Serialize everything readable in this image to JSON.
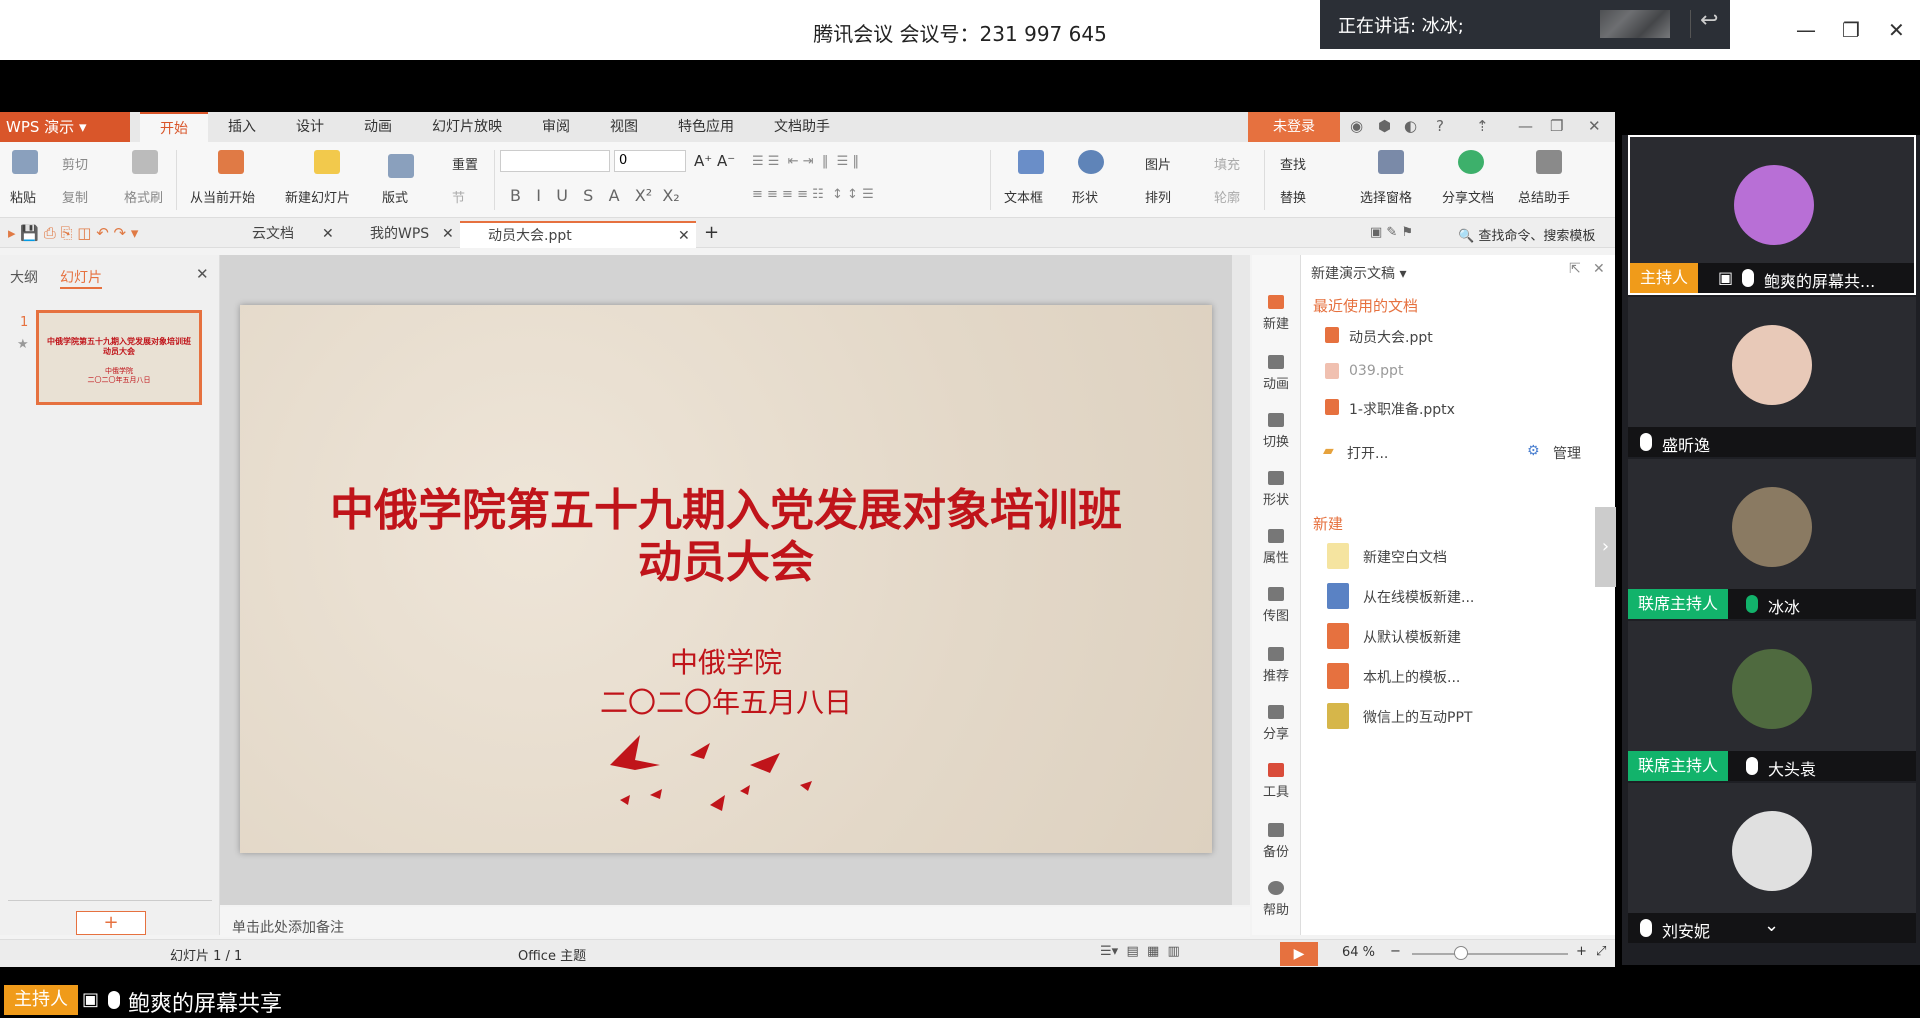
{
  "meeting": {
    "title": "腾讯会议 会议号：231 997 645",
    "speaking": "正在讲话: 冰冰;"
  },
  "wps": {
    "app_name": "WPS 演示",
    "menu_tabs": [
      "开始",
      "插入",
      "设计",
      "动画",
      "幻灯片放映",
      "审阅",
      "视图",
      "特色应用",
      "文档助手"
    ],
    "login": "未登录",
    "ribbon": {
      "paste": "粘贴",
      "cut": "剪切",
      "copy": "复制",
      "format_painter": "格式刷",
      "from_current": "从当前开始",
      "new_slide": "新建幻灯片",
      "layout": "版式",
      "reset": "重置",
      "section": "节",
      "font_size": "0",
      "textbox": "文本框",
      "shape": "形状",
      "picture": "图片",
      "fill": "填充",
      "arrange": "排列",
      "outline": "轮廓",
      "find": "查找",
      "replace": "替换",
      "selection_pane": "选择窗格",
      "share_doc": "分享文档",
      "summary": "总结助手"
    },
    "doc_tabs": [
      "云文档",
      "我的WPS",
      "动员大会.ppt"
    ],
    "search_cmd": "查找命令、搜索模板",
    "left_tabs": {
      "outline": "大纲",
      "slides": "幻灯片"
    },
    "slide_number": "1",
    "thumb_title": "中俄学院第五十九期入党发展对象培训班动员大会",
    "thumb_sub": "中俄学院\n二〇二〇年五月八日",
    "slide": {
      "title_line1": "中俄学院第五十九期入党发展对象培训班",
      "title_line2": "动员大会",
      "sub_line1": "中俄学院",
      "sub_line2": "二〇二〇年五月八日"
    },
    "notes": "单击此处添加备注",
    "side_tools": [
      "新建",
      "动画",
      "切换",
      "形状",
      "属性",
      "传图",
      "推荐",
      "分享",
      "工具",
      "备份",
      "帮助"
    ],
    "task_pane": {
      "title": "新建演示文稿",
      "recent_header": "最近使用的文档",
      "recent": [
        "动员大会.ppt",
        "039.ppt",
        "1-求职准备.pptx"
      ],
      "open": "打开...",
      "manage": "管理",
      "new_header": "新建",
      "new_items": [
        "新建空白文档",
        "从在线模板新建...",
        "从默认模板新建",
        "本机上的模板...",
        "微信上的互动PPT"
      ]
    },
    "status": {
      "slide_info": "幻灯片 1 / 1",
      "theme": "Office 主题",
      "zoom": "64 %"
    }
  },
  "participants": [
    {
      "role": "主持人",
      "name": "鲍爽的屏幕共...",
      "avatar_color": "#b86fd6"
    },
    {
      "role": "",
      "name": "盛昕逸",
      "avatar_color": "#e8c9b8"
    },
    {
      "role": "联席主持人",
      "name": "冰冰",
      "avatar_color": "#8a7a62"
    },
    {
      "role": "联席主持人",
      "name": "大头袁",
      "avatar_color": "#4f6a3f"
    },
    {
      "role": "",
      "name": "刘安妮",
      "avatar_color": "#e0e0e0"
    }
  ],
  "bottom": {
    "role": "主持人",
    "share": "鲍爽的屏幕共享"
  },
  "colors": {
    "accent": "#e6713f",
    "host": "#f09b1a",
    "cohost": "#12b36b",
    "slide_red": "#c0141a"
  }
}
